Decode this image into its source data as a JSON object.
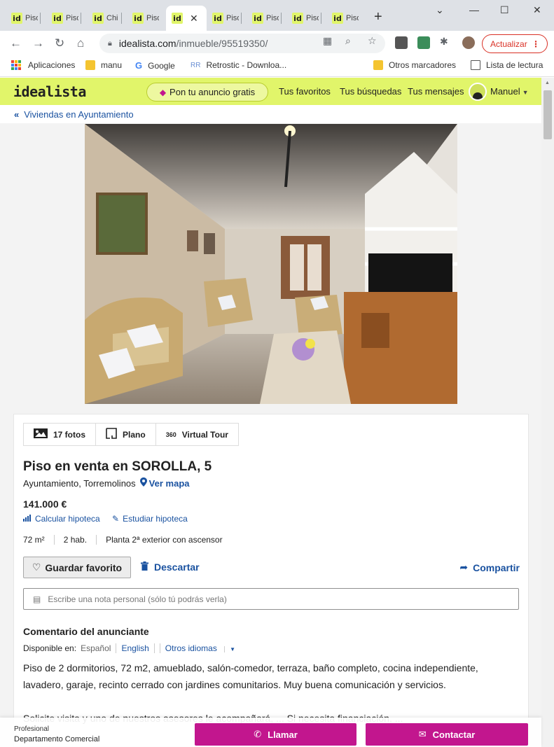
{
  "browser": {
    "tabs": [
      {
        "favicon": "id",
        "title": "Piso"
      },
      {
        "favicon": "id",
        "title": "Piso"
      },
      {
        "favicon": "id",
        "title": "Chi"
      },
      {
        "favicon": "id",
        "title": "Piso"
      },
      {
        "favicon": "id",
        "title": "",
        "active": true
      },
      {
        "favicon": "id",
        "title": "Piso"
      },
      {
        "favicon": "id",
        "title": "Piso"
      },
      {
        "favicon": "id",
        "title": "Piso"
      },
      {
        "favicon": "id",
        "title": "Piso"
      }
    ],
    "url_host": "idealista.com",
    "url_path": "/inmueble/95519350/",
    "update_label": "Actualizar",
    "bookmarks": {
      "apps": "Aplicaciones",
      "manu": "manu",
      "google": "Google",
      "retrostic": "Retrostic - Downloa...",
      "other": "Otros marcadores",
      "reading": "Lista de lectura"
    }
  },
  "site": {
    "logo": "idealista",
    "publish": "Pon tu anuncio gratis",
    "favorites": "Tus favoritos",
    "searches": "Tus búsquedas",
    "messages": "Tus mensajes",
    "user": "Manuel",
    "brand_color": "#e1f56a",
    "accent_color": "#c2168e",
    "link_color": "#1a52a0"
  },
  "breadcrumb": "Viviendas en Ayuntamiento",
  "listing": {
    "media": {
      "photos": "17 fotos",
      "plan": "Plano",
      "tour_badge": "360",
      "tour": "Virtual Tour"
    },
    "title": "Piso en venta en SOROLLA, 5",
    "location": "Ayuntamiento, Torremolinos",
    "map_link": "Ver mapa",
    "price": "141.000 €",
    "calc_mortgage": "Calcular hipoteca",
    "study_mortgage": "Estudiar hipoteca",
    "features": [
      "72 m²",
      "2 hab.",
      "Planta 2ª exterior con ascensor"
    ],
    "favorite_button": "Guardar favorito",
    "discard": "Descartar",
    "share": "Compartir",
    "note_placeholder": "Escribe una nota personal (sólo tú podrás verla)",
    "comment_title": "Comentario del anunciante",
    "available_in": "Disponible en:",
    "lang_current": "Español",
    "lang_english": "English",
    "lang_other": "Otros idiomas",
    "description": [
      "Piso de 2 dormitorios, 72 m2, amueblado, salón-comedor, terraza, baño completo, cocina independiente, lavadero, garaje, recinto cerrado con jardines comunitarios. Muy buena comunicación y servicios.",
      "Solicite visita y uno de nuestros asesores le acompañará, ... Si necesita financiación, ..."
    ]
  },
  "footer": {
    "professional": "Profesional",
    "department": "Departamento Comercial",
    "call": "Llamar",
    "contact": "Contactar"
  }
}
